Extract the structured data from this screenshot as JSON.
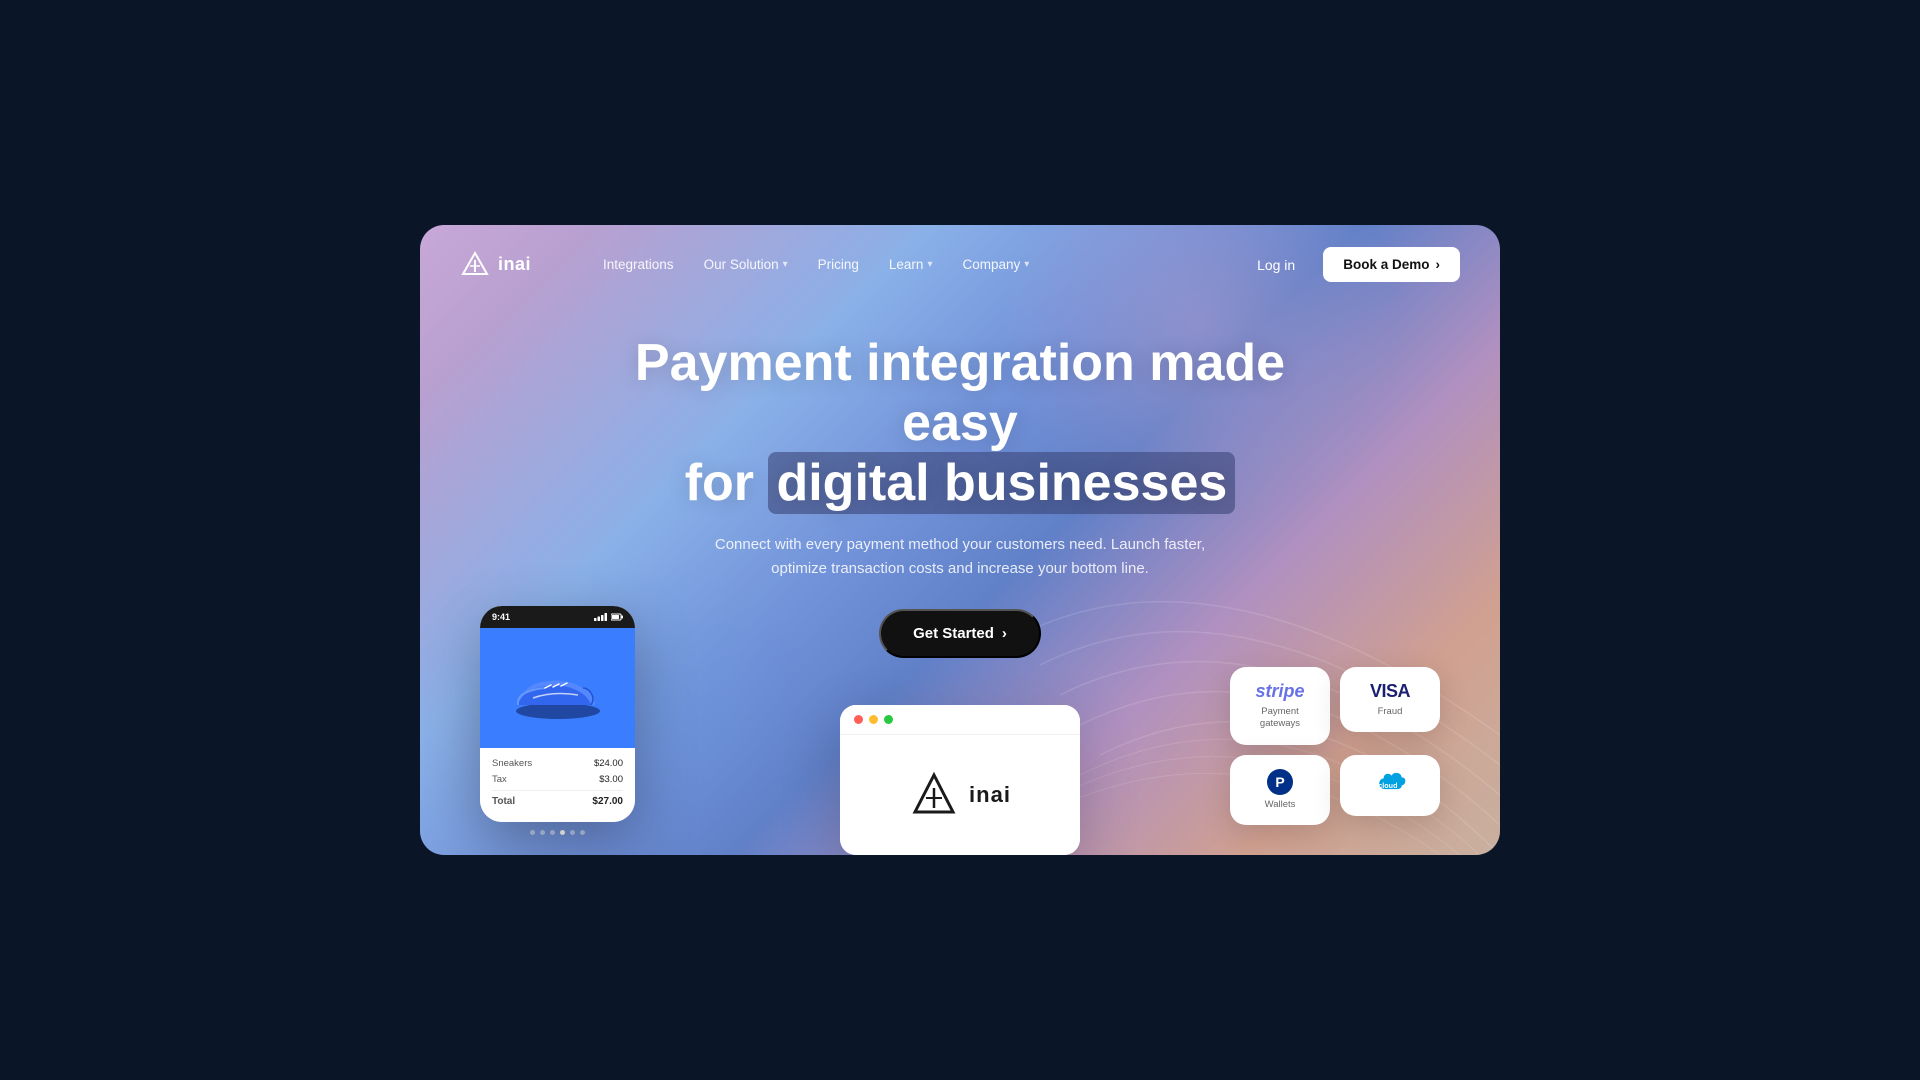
{
  "logo": {
    "text": "inai"
  },
  "nav": {
    "items": [
      {
        "label": "Integrations",
        "hasDropdown": false
      },
      {
        "label": "Our Solution",
        "hasDropdown": true
      },
      {
        "label": "Pricing",
        "hasDropdown": false
      },
      {
        "label": "Learn",
        "hasDropdown": true
      },
      {
        "label": "Company",
        "hasDropdown": true
      }
    ],
    "loginLabel": "Log in",
    "bookDemoLabel": "Book a Demo"
  },
  "hero": {
    "titleLine1": "Payment integration made easy",
    "titleLine2": "for ",
    "titleHighlight": "digital businesses",
    "subtitle": "Connect with every payment method your customers need. Launch faster, optimize transaction costs and increase your bottom line.",
    "ctaLabel": "Get Started"
  },
  "phone": {
    "time": "9:41",
    "productName": "Sneakers",
    "productPrice": "$24.00",
    "taxLabel": "Tax",
    "taxAmount": "$3.00",
    "totalLabel": "Total",
    "totalAmount": "$27.00"
  },
  "dots": [
    {
      "active": false
    },
    {
      "active": false
    },
    {
      "active": false
    },
    {
      "active": true
    },
    {
      "active": false
    },
    {
      "active": false
    }
  ],
  "paymentCards": [
    {
      "id": "stripe",
      "logo": "stripe",
      "label": "Payment\ngateways",
      "position": "top-left"
    },
    {
      "id": "visa",
      "logo": "VISA",
      "label": "Fraud",
      "position": "top-right"
    },
    {
      "id": "paypal",
      "logo": "P",
      "label": "Wallets",
      "position": "bottom-left"
    },
    {
      "id": "salesforce",
      "logo": "sf",
      "label": "",
      "position": "bottom-right"
    }
  ],
  "browserCard": {
    "logoText": "inai"
  },
  "colors": {
    "background": "#0a1628",
    "cardGradientStart": "#c8a0d8",
    "cardGradientEnd": "#7090d8",
    "stripeColor": "#6772e5",
    "visaColor": "#1a1f71",
    "paypalColor": "#003087",
    "salesforceColor": "#00a1e0",
    "ctaBackground": "#111111"
  }
}
